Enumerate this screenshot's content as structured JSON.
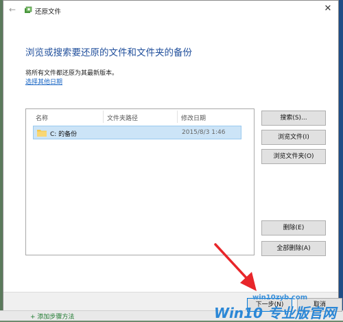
{
  "window": {
    "title": "还原文件",
    "back_glyph": "←",
    "close_glyph": "✕"
  },
  "content": {
    "heading": "浏览或搜索要还原的文件和文件夹的备份",
    "description": "将所有文件都还原为其最新版本。",
    "link": "选择其他日期"
  },
  "list": {
    "columns": [
      "名称",
      "文件夹路径",
      "修改日期"
    ],
    "rows": [
      {
        "name": "C: 的备份",
        "path": "",
        "modified": "2015/8/3 1:46",
        "icon": "folder-icon"
      }
    ]
  },
  "side_buttons": {
    "search": "搜索(S)...",
    "browse_files": "浏览文件(I)",
    "browse_folders": "浏览文件夹(O)",
    "delete": "删除(E)",
    "delete_all": "全部删除(A)"
  },
  "footer": {
    "next": "下一步(N)",
    "cancel": "取消"
  },
  "background": {
    "bottom_text": "+ 添加步骤方法"
  },
  "watermark": {
    "url": "win10zyb.com",
    "brand": "Win10 专业版官网"
  },
  "colors": {
    "heading": "#1f4e9b",
    "link": "#1a66c4",
    "selection": "#cce4f7",
    "arrow": "#e8262a",
    "primary_border": "#0078d7"
  }
}
